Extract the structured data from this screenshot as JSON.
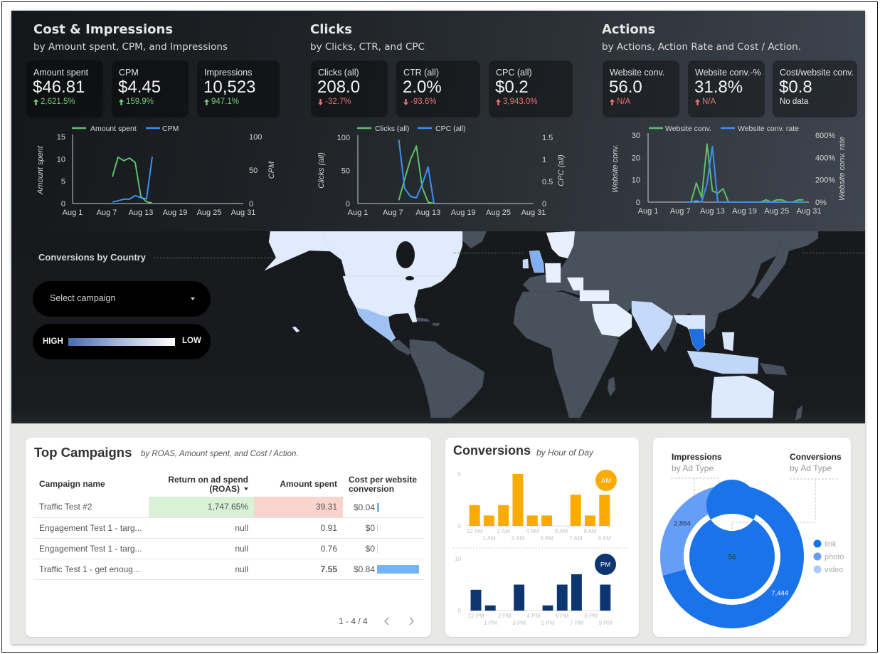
{
  "theme": {
    "positive": "#74c67a",
    "negative": "#e57373",
    "neutral": "#e6e6e6"
  },
  "dashboard": {
    "sections": [
      {
        "title": "Cost & Impressions",
        "subtitle": "by Amount spent, CPM, and Impressions",
        "scorecards": [
          {
            "label": "Amount spent",
            "value": "$46.81",
            "delta": "2,621.5%",
            "direction": "up",
            "sentiment": "positive"
          },
          {
            "label": "CPM",
            "value": "$4.45",
            "delta": "159.9%",
            "direction": "up",
            "sentiment": "positive"
          },
          {
            "label": "Impressions",
            "value": "10,523",
            "delta": "947.1%",
            "direction": "up",
            "sentiment": "positive"
          }
        ]
      },
      {
        "title": "Clicks",
        "subtitle": "by Clicks, CTR, and CPC",
        "scorecards": [
          {
            "label": "Clicks (all)",
            "value": "208.0",
            "delta": "-32.7%",
            "direction": "down",
            "sentiment": "negative"
          },
          {
            "label": "CTR (all)",
            "value": "2.0%",
            "delta": "-93.6%",
            "direction": "down",
            "sentiment": "negative"
          },
          {
            "label": "CPC (all)",
            "value": "$0.2",
            "delta": "3,943.0%",
            "direction": "up",
            "sentiment": "negative"
          }
        ]
      },
      {
        "title": "Actions",
        "subtitle": "by Actions, Action Rate and Cost / Action.",
        "scorecards": [
          {
            "label": "Website conv.",
            "value": "56.0",
            "delta": "N/A",
            "direction": "up",
            "sentiment": "negative"
          },
          {
            "label": "Website conv.-%",
            "value": "31.8%",
            "delta": "N/A",
            "direction": "up",
            "sentiment": "negative"
          },
          {
            "label": "Cost/website conv.",
            "value": "$0.8",
            "delta": "No data",
            "direction": null,
            "sentiment": "neutral"
          }
        ]
      }
    ]
  },
  "map": {
    "title": "Conversions by Country",
    "campaign_select": {
      "placeholder": "Select campaign",
      "value": ""
    },
    "legend": {
      "high_label": "HIGH",
      "low_label": "LOW"
    },
    "scale_colors": {
      "high": "#1f6fe0",
      "low": "#eef4ff"
    },
    "countries": [
      {
        "name": "Canada",
        "intensity": 0.07
      },
      {
        "name": "United States",
        "intensity": 0.07
      },
      {
        "name": "Mexico",
        "intensity": 0.38
      },
      {
        "name": "United Kingdom",
        "intensity": 0.52
      },
      {
        "name": "Ireland",
        "intensity": 0.2
      },
      {
        "name": "Norway",
        "intensity": 0.03
      },
      {
        "name": "Germany",
        "intensity": 0.03
      },
      {
        "name": "Italy",
        "intensity": 0.02
      },
      {
        "name": "Turkey",
        "intensity": 0.02
      },
      {
        "name": "Saudi Arabia",
        "intensity": 0.04
      },
      {
        "name": "India",
        "intensity": 0.2
      },
      {
        "name": "Vietnam",
        "intensity": 0.1
      },
      {
        "name": "Thailand",
        "intensity": 1.0
      },
      {
        "name": "Indonesia",
        "intensity": 0.22
      },
      {
        "name": "Philippines",
        "intensity": 0.1
      },
      {
        "name": "Australia",
        "intensity": 0.08
      }
    ]
  },
  "table": {
    "title": "Top Campaigns",
    "subtitle": "by ROAS, Amount spent, and Cost / Action.",
    "columns": [
      {
        "label": "Campaign name"
      },
      {
        "label": "Return on ad spend\n(ROAS)",
        "sort": "desc"
      },
      {
        "label": "Amount spent"
      },
      {
        "label": "Cost per website\nconversion"
      }
    ],
    "rows": [
      {
        "name": "Traffic Test #2",
        "roas": "1,747.65%",
        "amount": "39.31",
        "cost": "$0.04",
        "cost_value": 0.04
      },
      {
        "name": "Engagement Test 1 - targ...",
        "roas": "null",
        "amount": "0.91",
        "cost": "$0",
        "cost_value": 0
      },
      {
        "name": "Engagement Test 1 - targ...",
        "roas": "null",
        "amount": "0.76",
        "cost": "$0",
        "cost_value": 0
      },
      {
        "name": "Traffic Test 1 - get enoug...",
        "roas": "null",
        "amount": "7.55",
        "cost": "$0.84",
        "cost_value": 0.84
      }
    ],
    "pagination": {
      "range": "1 - 4 / 4"
    }
  },
  "conversions_by_hour": {
    "title": "Conversions",
    "subtitle": "by Hour of Day",
    "am_badge": "AM",
    "pm_badge": "PM"
  },
  "ad_type": {
    "impressions_title": "Impressions",
    "impressions_subtitle": "by Ad Type",
    "conversions_title": "Conversions",
    "conversions_subtitle": "by Ad Type",
    "legend": [
      {
        "label": "link",
        "color": "#1a73e8"
      },
      {
        "label": "photo",
        "color": "#669df6"
      },
      {
        "label": "video",
        "color": "#aecbfa"
      }
    ]
  },
  "chart_data": [
    {
      "type": "line",
      "title": "Cost & Impressions",
      "x_month": "Aug",
      "x_days": [
        1,
        2,
        3,
        4,
        5,
        6,
        7,
        8,
        9,
        10,
        11,
        12,
        13,
        14,
        15,
        16,
        17,
        18,
        19,
        20,
        21,
        22,
        23,
        24,
        25,
        26,
        27,
        28,
        29,
        30,
        31
      ],
      "xtick_days": [
        1,
        7,
        13,
        19,
        25,
        31
      ],
      "xtick_labels": [
        "Aug 1",
        "Aug 7",
        "Aug 13",
        "Aug 19",
        "Aug 25",
        "Aug 31"
      ],
      "y_left": {
        "label": "Amount spent",
        "range": [
          0,
          15
        ],
        "ticks": [
          0,
          5,
          10,
          15
        ],
        "tick_labels": [
          "0",
          "5",
          "10",
          "15"
        ]
      },
      "y_right": {
        "label": "CPM",
        "range": [
          0,
          100
        ],
        "ticks": [
          0,
          50,
          100
        ],
        "tick_labels": [
          "0",
          "50",
          "100"
        ]
      },
      "grid": false,
      "legend": "top",
      "series": [
        {
          "name": "Amount spent",
          "axis": "left",
          "color": "#5fbf68",
          "values": [
            null,
            null,
            null,
            null,
            null,
            null,
            null,
            6.0,
            10.4,
            9.6,
            10.2,
            9.2,
            1.6,
            0.4,
            0.1,
            null,
            null,
            null,
            null,
            null,
            null,
            null,
            null,
            null,
            null,
            null,
            null,
            null,
            null,
            null,
            null
          ]
        },
        {
          "name": "CPM",
          "axis": "right",
          "color": "#3d8ff2",
          "values": [
            null,
            null,
            null,
            null,
            null,
            null,
            null,
            2.5,
            4,
            6.5,
            6.5,
            12,
            8.5,
            7,
            70,
            null,
            null,
            null,
            null,
            null,
            null,
            null,
            null,
            null,
            null,
            null,
            null,
            null,
            null,
            null,
            null
          ]
        }
      ]
    },
    {
      "type": "line",
      "title": "Clicks",
      "x_month": "Aug",
      "x_days": [
        1,
        2,
        3,
        4,
        5,
        6,
        7,
        8,
        9,
        10,
        11,
        12,
        13,
        14,
        15,
        16,
        17,
        18,
        19,
        20,
        21,
        22,
        23,
        24,
        25,
        26,
        27,
        28,
        29,
        30,
        31
      ],
      "xtick_days": [
        1,
        7,
        13,
        19,
        25,
        31
      ],
      "xtick_labels": [
        "Aug 1",
        "Aug 7",
        "Aug 13",
        "Aug 19",
        "Aug 25",
        "Aug 31"
      ],
      "y_left": {
        "label": "Clicks (all)",
        "range": [
          0,
          100
        ],
        "ticks": [
          0,
          50,
          100
        ],
        "tick_labels": [
          "0",
          "50",
          "100"
        ]
      },
      "y_right": {
        "label": "CPC (all)",
        "range": [
          0,
          1.5
        ],
        "ticks": [
          0,
          0.5,
          1,
          1.5
        ],
        "tick_labels": [
          "0",
          "0.5",
          "1",
          "1.5"
        ]
      },
      "grid": false,
      "legend": "top",
      "series": [
        {
          "name": "Clicks (all)",
          "axis": "left",
          "color": "#5fbf68",
          "values": [
            null,
            null,
            null,
            null,
            null,
            null,
            null,
            5,
            37,
            67,
            87,
            24,
            2,
            0,
            null,
            null,
            null,
            null,
            null,
            null,
            null,
            null,
            null,
            null,
            null,
            null,
            null,
            null,
            null,
            null,
            null
          ]
        },
        {
          "name": "CPC (all)",
          "axis": "right",
          "color": "#3d8ff2",
          "values": [
            null,
            null,
            null,
            null,
            null,
            null,
            null,
            1.45,
            0.34,
            0.16,
            0.13,
            0.44,
            0.83,
            0,
            0,
            null,
            null,
            null,
            null,
            null,
            null,
            null,
            null,
            null,
            null,
            null,
            null,
            null,
            null,
            null,
            null
          ]
        }
      ]
    },
    {
      "type": "line",
      "title": "Actions",
      "x_month": "Aug",
      "x_days": [
        1,
        2,
        3,
        4,
        5,
        6,
        7,
        8,
        9,
        10,
        11,
        12,
        13,
        14,
        15,
        16,
        17,
        18,
        19,
        20,
        21,
        22,
        23,
        24,
        25,
        26,
        27,
        28,
        29,
        30,
        31
      ],
      "xtick_days": [
        1,
        7,
        13,
        19,
        25,
        31
      ],
      "xtick_labels": [
        "Aug 1",
        "Aug 7",
        "Aug 13",
        "Aug 19",
        "Aug 25",
        "Aug 31"
      ],
      "y_left": {
        "label": "Website conv.",
        "range": [
          0,
          30
        ],
        "ticks": [
          0,
          10,
          20,
          30
        ],
        "tick_labels": [
          "0",
          "10",
          "20",
          "30"
        ]
      },
      "y_right": {
        "label": "Website conv. rate",
        "range": [
          0,
          600
        ],
        "ticks": [
          0,
          200,
          400,
          600
        ],
        "tick_labels": [
          "0%",
          "200%",
          "400%",
          "600%"
        ]
      },
      "grid": false,
      "legend": "top",
      "series": [
        {
          "name": "Website conv.",
          "axis": "left",
          "color": "#5fbf68",
          "values": [
            null,
            null,
            null,
            null,
            null,
            null,
            null,
            0,
            0,
            8.6,
            2,
            26,
            5,
            4,
            6,
            0,
            0,
            0,
            0,
            0,
            0,
            0,
            1,
            0,
            1,
            1,
            0,
            0,
            1,
            1,
            null
          ]
        },
        {
          "name": "Website conv. rate",
          "axis": "right",
          "color": "#3d8ff2",
          "values": [
            null,
            null,
            null,
            null,
            null,
            null,
            null,
            0,
            0,
            12,
            0,
            165,
            500,
            0,
            0,
            0,
            0,
            0,
            0,
            0,
            0,
            0,
            0,
            0,
            0,
            0,
            0,
            0,
            0,
            0,
            null
          ]
        }
      ]
    },
    {
      "type": "bar",
      "title": "Conversions by Hour of Day (AM)",
      "categories": [
        "12 AM",
        "1 AM",
        "2 AM",
        "3 AM",
        "4 AM",
        "5 AM",
        "6 AM",
        "7 AM",
        "8 AM",
        "9 AM"
      ],
      "values": [
        2,
        1,
        2,
        5,
        1,
        1,
        0,
        3,
        1,
        3
      ],
      "ylim": [
        0,
        5
      ],
      "yticks": [
        0,
        5
      ],
      "ytick_labels": [
        "0",
        "5"
      ],
      "color": "#f9ab00"
    },
    {
      "type": "bar",
      "title": "Conversions by Hour of Day (PM)",
      "categories": [
        "12 PM",
        "1 PM",
        "2 PM",
        "3 PM",
        "4 PM",
        "5 PM",
        "6 PM",
        "7 PM",
        "8 PM",
        "9 PM"
      ],
      "values": [
        4,
        1,
        0,
        5,
        0,
        1,
        5,
        7,
        0,
        5
      ],
      "ylim": [
        0,
        10
      ],
      "yticks": [
        0,
        10
      ],
      "ytick_labels": [
        "0",
        "10"
      ],
      "color": "#0d3570"
    },
    {
      "type": "pie",
      "title": "Impressions / Conversions by Ad Type",
      "rings": [
        {
          "name": "Impressions",
          "labels": [
            "link",
            "photo",
            "video"
          ],
          "values": [
            7444,
            2884,
            195
          ],
          "data_labels": [
            "7,444",
            "2,884",
            ""
          ]
        },
        {
          "name": "Conversions",
          "labels": [
            "link"
          ],
          "values": [
            56
          ],
          "data_labels": [
            "56"
          ]
        }
      ],
      "legend": "right"
    }
  ]
}
